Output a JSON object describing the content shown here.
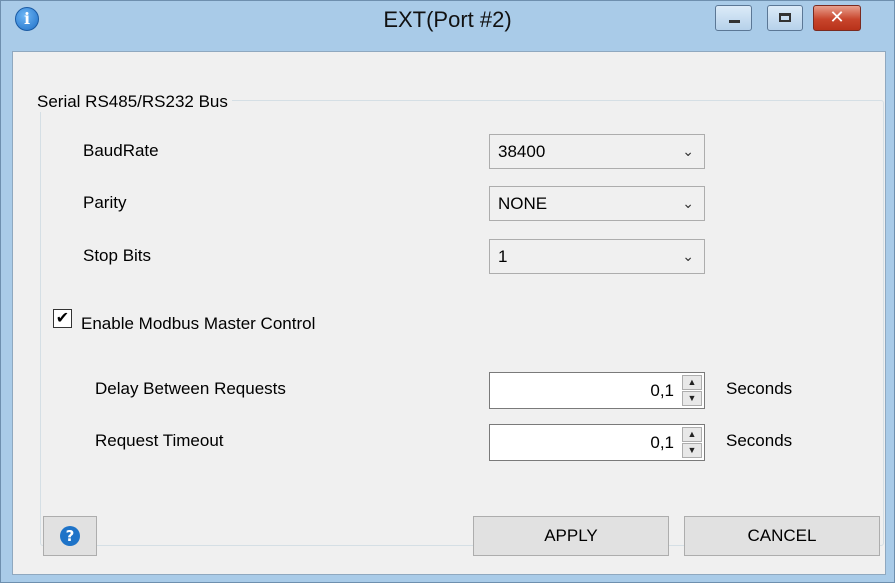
{
  "window": {
    "title": "EXT(Port #2)"
  },
  "group": {
    "title": "Serial RS485/RS232 Bus"
  },
  "serial": {
    "baud_label": "BaudRate",
    "baud_value": "38400",
    "parity_label": "Parity",
    "parity_value": "NONE",
    "stop_label": "Stop Bits",
    "stop_value": "1"
  },
  "modbus": {
    "enable_label": "Enable Modbus Master Control",
    "enable_checked": true,
    "check_glyph": "✔",
    "delay_label": "Delay Between Requests",
    "delay_value": "0,1",
    "delay_unit": "Seconds",
    "timeout_label": "Request Timeout",
    "timeout_value": "0,1",
    "timeout_unit": "Seconds"
  },
  "buttons": {
    "apply": "APPLY",
    "cancel": "CANCEL",
    "help_glyph": "?"
  },
  "glyphs": {
    "info": "i",
    "close": "✕",
    "combo_arrow": "⌄",
    "spin_up": "▲",
    "spin_down": "▼"
  },
  "icons": [
    "info-icon",
    "minimize-icon",
    "maximize-icon",
    "close-icon",
    "help-icon",
    "chevron-down-icon",
    "checkmark-icon"
  ]
}
